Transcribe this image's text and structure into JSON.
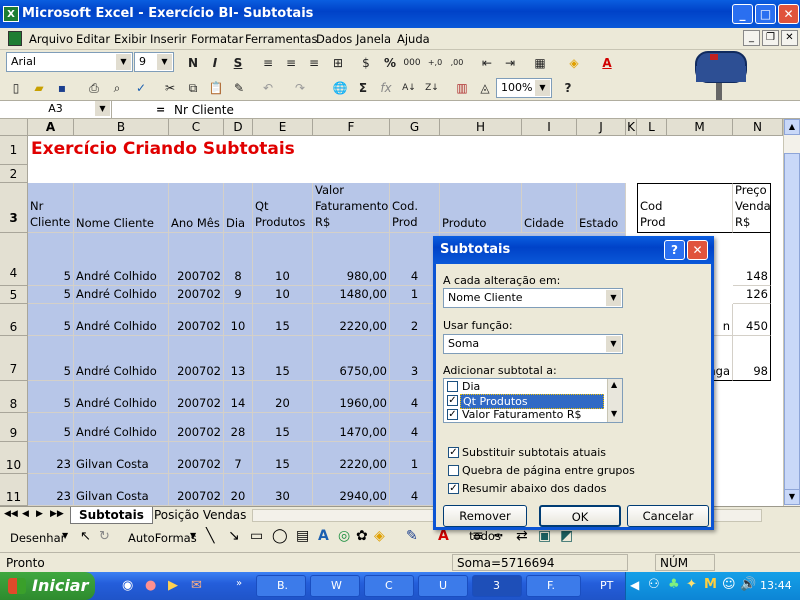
{
  "window": {
    "title": "Microsoft Excel - Exercício BI- Subtotais",
    "icon": "excel-icon"
  },
  "menu": [
    "Arquivo",
    "Editar",
    "Exibir",
    "Inserir",
    "Formatar",
    "Ferramentas",
    "Dados",
    "Janela",
    "Ajuda"
  ],
  "format_toolbar": {
    "font": "Arial",
    "size": "9"
  },
  "standard_toolbar": {
    "zoom": "100%"
  },
  "formula_bar": {
    "name_box": "A3",
    "fx": "=",
    "value": "Nr Cliente"
  },
  "columns": [
    "A",
    "B",
    "C",
    "D",
    "E",
    "F",
    "G",
    "H",
    "I",
    "J",
    "K",
    "L",
    "M",
    "N"
  ],
  "title_cell": "Exercício Criando Subtotais",
  "headers": [
    "Nr Cliente",
    "Nome Cliente",
    "Ano Mês",
    "Dia",
    "Qt Produtos",
    "Valor Faturamento R$",
    "Cod. Prod",
    "Produto",
    "Cidade",
    "Estado"
  ],
  "side_headers": {
    "cod_prod": "Cod Prod",
    "preco": "Preço Venda R$"
  },
  "rows": [
    {
      "row": "1"
    },
    {
      "row": "2"
    },
    {
      "row": "3"
    },
    {
      "row": "4",
      "cliente": "5",
      "nome": "André Colhido",
      "anomes": "200702",
      "dia": "8",
      "qt": "10",
      "valor": "980,00",
      "cod": "4",
      "preco": "148",
      "mtext": ""
    },
    {
      "row": "5",
      "cliente": "5",
      "nome": "André Colhido",
      "anomes": "200702",
      "dia": "9",
      "qt": "10",
      "valor": "1480,00",
      "cod": "1",
      "preco": "126",
      "mtext": ""
    },
    {
      "row": "6",
      "cliente": "5",
      "nome": "André Colhido",
      "anomes": "200702",
      "dia": "10",
      "qt": "15",
      "valor": "2220,00",
      "cod": "2",
      "preco": "450",
      "mtext": "n"
    },
    {
      "row": "7",
      "cliente": "5",
      "nome": "André Colhido",
      "anomes": "200702",
      "dia": "13",
      "qt": "15",
      "valor": "6750,00",
      "cod": "3",
      "preco": "98",
      "mtext": "nga"
    },
    {
      "row": "8",
      "cliente": "5",
      "nome": "André Colhido",
      "anomes": "200702",
      "dia": "14",
      "qt": "20",
      "valor": "1960,00",
      "cod": "4"
    },
    {
      "row": "9",
      "cliente": "5",
      "nome": "André Colhido",
      "anomes": "200702",
      "dia": "28",
      "qt": "15",
      "valor": "1470,00",
      "cod": "4"
    },
    {
      "row": "10",
      "cliente": "23",
      "nome": "Gilvan Costa",
      "anomes": "200702",
      "dia": "7",
      "qt": "15",
      "valor": "2220,00",
      "cod": "1"
    },
    {
      "row": "11",
      "cliente": "23",
      "nome": "Gilvan Costa",
      "anomes": "200702",
      "dia": "20",
      "qt": "30",
      "valor": "2940,00",
      "cod": "4"
    }
  ],
  "sheet_tabs": [
    "Subtotais",
    "Posição Vendas"
  ],
  "draw_toolbar": {
    "draw": "Desenhar",
    "autoshapes": "AutoFormas"
  },
  "status": {
    "left": "Pronto",
    "sum": "Soma=5716694",
    "num": "NÚM"
  },
  "dialog": {
    "title": "Subtotais",
    "help": "?",
    "close": "✕",
    "label_change": "A cada alteração em:",
    "change_value": "Nome Cliente",
    "label_function": "Usar função:",
    "function_value": "Soma",
    "label_add": "Adicionar subtotal a:",
    "list": [
      {
        "label": "Dia",
        "checked": false,
        "mark": ""
      },
      {
        "label": "Qt Produtos",
        "checked": true,
        "mark": "✓"
      },
      {
        "label": "Valor Faturamento R$",
        "checked": true,
        "mark": "✓"
      }
    ],
    "opt_replace": "Substituir subtotais atuais",
    "opt_replace_mark": "✓",
    "opt_pagebreak": "Quebra de página entre grupos",
    "opt_pagebreak_mark": "",
    "opt_summary": "Resumir abaixo dos dados",
    "opt_summary_mark": "✓",
    "btn_remove": "Remover todos",
    "btn_ok": "OK",
    "btn_cancel": "Cancelar"
  },
  "taskbar": {
    "start": "Iniciar",
    "tasks": [
      "B.",
      "W",
      "C",
      "U",
      "3",
      "F."
    ],
    "lang": "PT",
    "clock": "13:44"
  },
  "colors": {
    "accent": "#0a58d8",
    "selection": "#b7c6e8",
    "title_red": "#e00000",
    "start_green": "#2e8b2e"
  }
}
